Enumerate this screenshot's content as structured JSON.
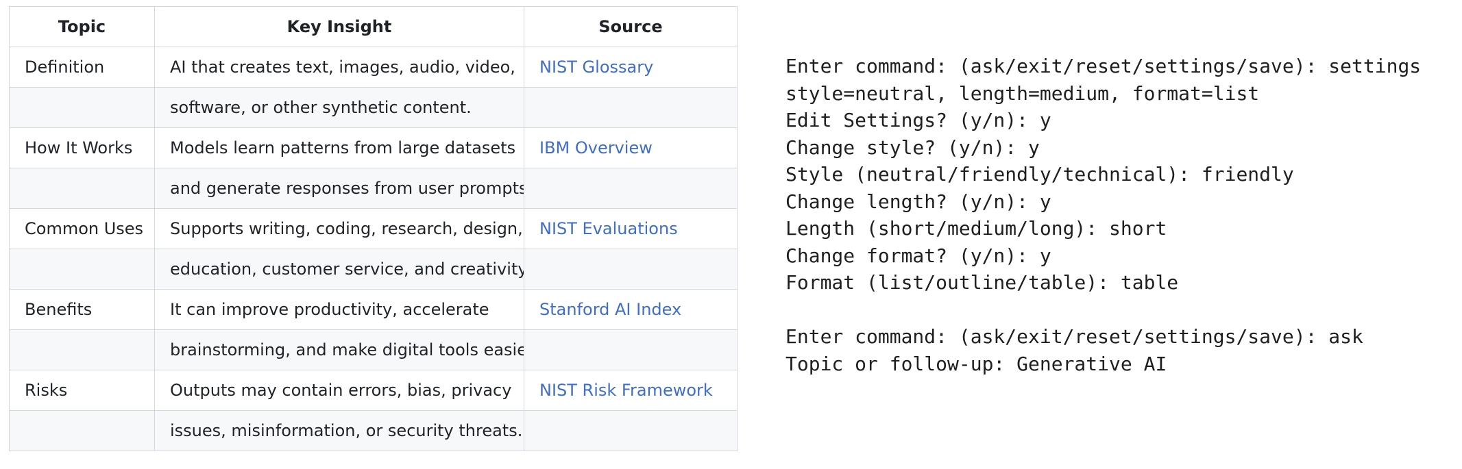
{
  "table": {
    "headers": [
      "Topic",
      "Key Insight",
      "Source"
    ],
    "rows": [
      {
        "topic": "Definition",
        "insight_line1": "AI that creates text, images, audio, video,",
        "insight_line2": "software, or other synthetic content.",
        "source": "NIST Glossary"
      },
      {
        "topic": "How It Works",
        "insight_line1": "Models learn patterns from large datasets",
        "insight_line2": "and generate responses from user prompts.",
        "source": "IBM Overview"
      },
      {
        "topic": "Common Uses",
        "insight_line1": "Supports writing, coding, research, design,",
        "insight_line2": "education, customer service, and creativity.",
        "source": "NIST Evaluations"
      },
      {
        "topic": "Benefits",
        "insight_line1": "It can improve productivity, accelerate",
        "insight_line2": "brainstorming, and make digital tools easier.",
        "source": "Stanford AI Index"
      },
      {
        "topic": "Risks",
        "insight_line1": "Outputs may contain errors, bias, privacy",
        "insight_line2": "issues, misinformation, or security threats.",
        "source": "NIST Risk Framework"
      }
    ]
  },
  "terminal": {
    "lines": [
      "Enter command: (ask/exit/reset/settings/save): settings",
      "style=neutral, length=medium, format=list",
      "Edit Settings? (y/n): y",
      "Change style? (y/n): y",
      "Style (neutral/friendly/technical): friendly",
      "Change length? (y/n): y",
      "Length (short/medium/long): short",
      "Change format? (y/n): y",
      "Format (list/outline/table): table",
      "",
      "Enter command: (ask/exit/reset/settings/save): ask",
      "Topic or follow-up: Generative AI"
    ]
  },
  "colors": {
    "link": "#3f6ec9",
    "border": "#d4d8de",
    "stripe": "#f6f8fa",
    "text": "#1f2328"
  }
}
